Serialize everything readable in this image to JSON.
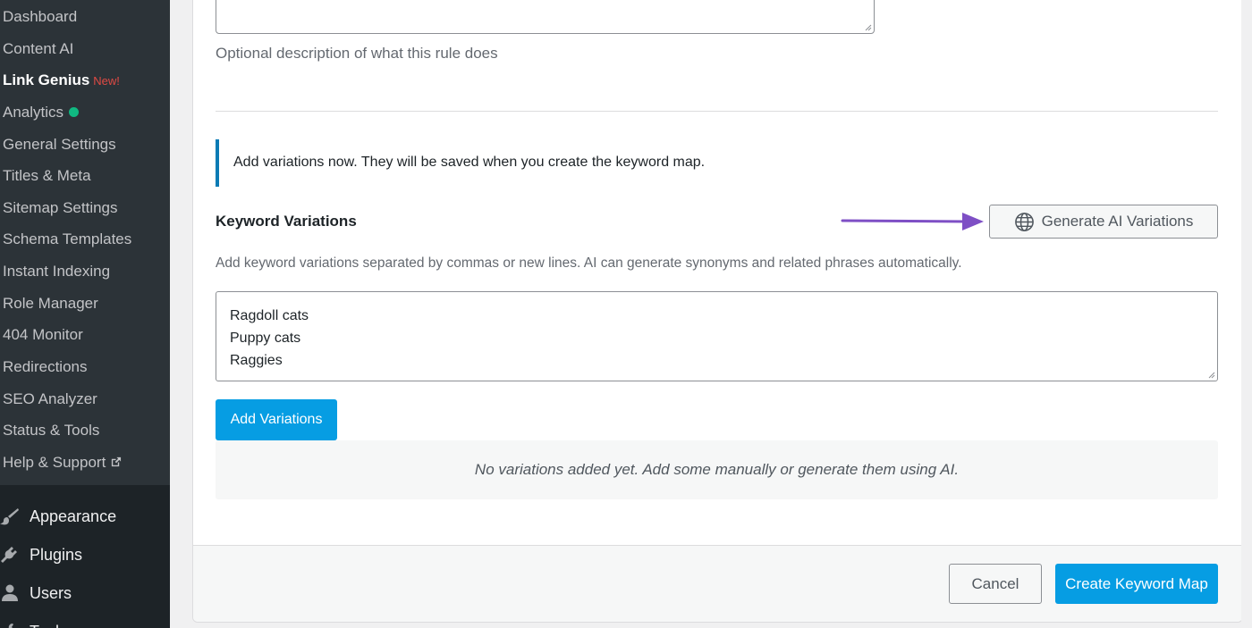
{
  "sidebar": {
    "submenu": [
      {
        "label": "Dashboard"
      },
      {
        "label": "Content AI"
      },
      {
        "label": "Link Genius",
        "badge": "New!"
      },
      {
        "label": "Analytics"
      },
      {
        "label": "General Settings"
      },
      {
        "label": "Titles & Meta"
      },
      {
        "label": "Sitemap Settings"
      },
      {
        "label": "Schema Templates"
      },
      {
        "label": "Instant Indexing"
      },
      {
        "label": "Role Manager"
      },
      {
        "label": "404 Monitor"
      },
      {
        "label": "Redirections"
      },
      {
        "label": "SEO Analyzer"
      },
      {
        "label": "Status & Tools"
      },
      {
        "label": "Help & Support"
      }
    ],
    "menu": [
      {
        "label": "Appearance",
        "icon": "paintbrush-icon"
      },
      {
        "label": "Plugins",
        "icon": "plugin-icon"
      },
      {
        "label": "Users",
        "icon": "users-icon"
      },
      {
        "label": "Tools",
        "icon": "tools-icon"
      }
    ]
  },
  "form": {
    "description_help": "Optional description of what this rule does",
    "notice": "Add variations now. They will be saved when you create the keyword map.",
    "variations_heading": "Keyword Variations",
    "generate_button": "Generate AI Variations",
    "variations_help": "Add keyword variations separated by commas or new lines. AI can generate synonyms and related phrases automatically.",
    "variations_lines": [
      "Ragdoll cats",
      "Puppy cats",
      "Raggies"
    ],
    "add_button": "Add Variations",
    "empty_state": "No variations added yet. Add some manually or generate them using AI."
  },
  "footer": {
    "cancel_button": "Cancel",
    "create_button": "Create Keyword Map"
  },
  "colors": {
    "accent": "#069de3",
    "notice_border": "#0a7bb5",
    "arrow": "#7e4fc5",
    "sidebar_bg": "#1d2327",
    "submenu_bg": "#2c3338",
    "new_badge": "#e04a44",
    "status_dot": "#10b981"
  }
}
